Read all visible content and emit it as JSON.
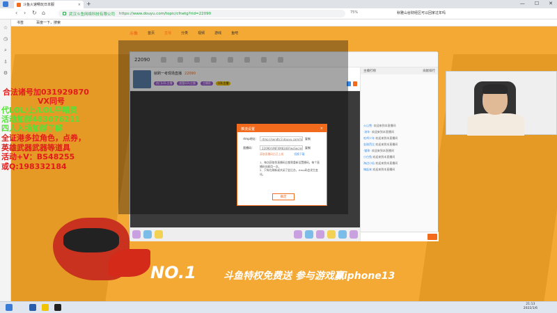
{
  "browser": {
    "tab_title": "斗鱼火速畅玩日本服",
    "site_name": "武汉斗鱼网络科技有限公司",
    "url": "https://www.douyu.com/topic/cfnetg?rid=22090",
    "zoom": "75%",
    "right_text": "秋雅山谷财经区可以回家过年吗",
    "bookmarks": [
      "书签",
      "百度一下，搜索"
    ]
  },
  "site_header": {
    "logo": "斗鱼",
    "nav": [
      "首页",
      "直播",
      "分类",
      "视频",
      "游戏",
      "鱼吧"
    ]
  },
  "room": {
    "title": "就刷一考现场直播",
    "room_id": "22090",
    "tags": [
      "热门LOL主播",
      "超管LOL主播",
      "主播家",
      "LOL主播"
    ],
    "chat_header": "主播打榜",
    "chat_header_right": "贡献排行",
    "chat_messages": [
      {
        "user": "火山雪·",
        "text": "欢迎来到本直播间"
      },
      {
        "user": "·流年·",
        "text": "欢迎来到本直播间"
      },
      {
        "user": "吃鸡少年",
        "text": "欢迎来到本直播间"
      },
      {
        "user": "金刚芭比",
        "text": "欢迎来到本直播间"
      },
      {
        "user": "·猫咪·",
        "text": "欢迎来到本直播间"
      },
      {
        "user": "小白兔",
        "text": "欢迎来到本直播间"
      },
      {
        "user": "海边小仙",
        "text": "欢迎来到本直播间"
      },
      {
        "user": "嗨起来",
        "text": "欢迎来到本直播间"
      }
    ]
  },
  "modal": {
    "title": "推流设置",
    "rtmp_label": "rtmp地址：",
    "rtmp_value": "rtmp://sendtc3.douyu.com/live",
    "key_label": "直播码：",
    "key_value": "22090rVNFXM8348?wsSecret=",
    "copy_label": "复制",
    "note": "获取直播码后已上线",
    "note2": "切换下载",
    "tips": [
      "1、每次获取到直播码后都需重新设置播码，每个直播码仅能用一次。",
      "2、只有在刷新或关闭了此后台，rtmp码会发生变化。"
    ],
    "confirm": "确定"
  },
  "promo": {
    "no1": "NO.1",
    "slogan": "斗鱼特权免费送 参与游戏赢iphone13"
  },
  "overlay_texts": [
    {
      "text": "合法诸号加031929870",
      "color": "red"
    },
    {
      "text": "VX同号",
      "color": "red"
    },
    {
      "text": "代LOL/上/LOL平精灵",
      "color": "grn"
    },
    {
      "text": "活动加群483076211",
      "color": "grn"
    },
    {
      "text": "四人入场加群了解",
      "color": "grn"
    },
    {
      "text": "全证港多拉角色，点券，",
      "color": "red"
    },
    {
      "text": "英雄武器武器等道具",
      "color": "red"
    },
    {
      "text": "活动+V：BS48255",
      "color": "red"
    },
    {
      "text": "或Q:198332184",
      "color": "red"
    }
  ],
  "taskbar": {
    "time": "21:13",
    "date": "2022/1/6"
  }
}
